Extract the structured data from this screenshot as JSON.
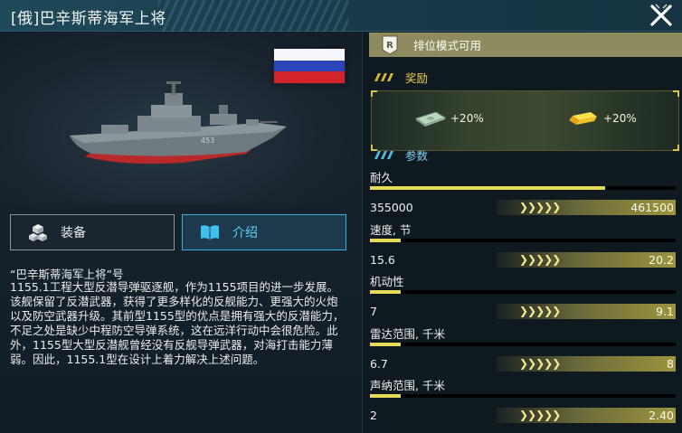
{
  "header": {
    "title": "[俄]巴辛斯蒂海军上将"
  },
  "tabs": {
    "equipment": "装备",
    "intro": "介绍"
  },
  "description": {
    "title": "“巴辛斯蒂海军上将”号",
    "body": "1155.1工程大型反潜导弹驱逐舰，作为1155项目的进一步发展。该舰保留了反潜武器，获得了更多样化的反舰能力、更强大的火炮以及防空武器升级。其前型1155型的优点是拥有强大的反潜能力，不足之处是缺少中程防空导弹系统，这在远洋行动中会很危险。此外，1155型大型反潜舰曾经没有反舰导弹武器，对海打击能力薄弱。因此，1155.1型在设计上着力解决上述问题。"
  },
  "rank": {
    "label": "排位模式可用"
  },
  "rewards": {
    "heading": "奖励",
    "items": [
      {
        "icon": "cash-icon",
        "value": "+20%"
      },
      {
        "icon": "gold-bar-icon",
        "value": "+20%"
      }
    ]
  },
  "params": {
    "heading": "参数",
    "stats": [
      {
        "label": "耐久",
        "base": "355000",
        "max": "461500",
        "fill": 0.77
      },
      {
        "label": "速度, 节",
        "base": "15.6",
        "max": "20.2",
        "fill": 0.1
      },
      {
        "label": "机动性",
        "base": "7",
        "max": "9.1",
        "fill": 0.1
      },
      {
        "label": "雷达范围, 千米",
        "base": "6.7",
        "max": "8",
        "fill": 0.1
      },
      {
        "label": "声纳范围, 千米",
        "base": "2",
        "max": "2.40",
        "fill": 0.1
      }
    ]
  },
  "colors": {
    "accent_cyan": "#35b4e0",
    "accent_yellow": "#e6da5a",
    "rank_bar": "#8e8c5f"
  }
}
